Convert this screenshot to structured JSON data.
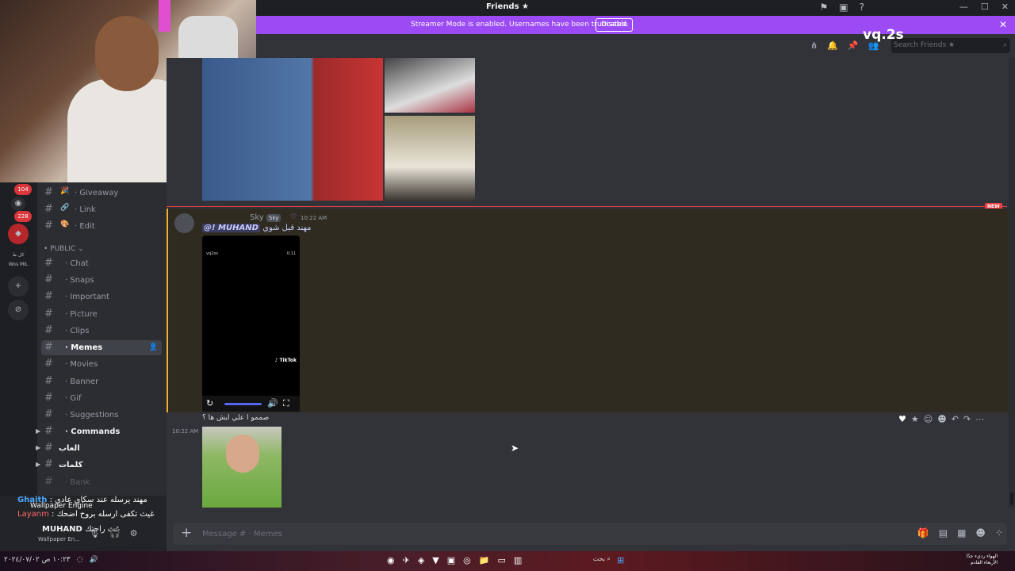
{
  "titlebar": {
    "title": "Friends ★",
    "icons": [
      "flag-icon",
      "inbox-icon",
      "help-icon"
    ]
  },
  "banner": {
    "text": "Streamer Mode is enabled. Usernames have been truncated.",
    "button": "Disable",
    "close": "✕"
  },
  "header": {
    "search_placeholder": "Search Friends ★"
  },
  "watermark": "vq.2s",
  "serverbar": {
    "badges": [
      "104",
      "228"
    ],
    "labels": [
      "كل",
      "ط",
      "Wos MIL"
    ]
  },
  "sidebar": {
    "category": "• PUBLIC ⌄",
    "channels": [
      {
        "name": "· Giveaway",
        "emoji": "🎉"
      },
      {
        "name": "· Link",
        "emoji": "🔗"
      },
      {
        "name": "· Edit",
        "emoji": "🎨"
      },
      {
        "name": "· Chat"
      },
      {
        "name": "· Snaps"
      },
      {
        "name": "· Important"
      },
      {
        "name": "· Picture"
      },
      {
        "name": "· Clips"
      },
      {
        "name": "· Memes",
        "active": true
      },
      {
        "name": "· Movies"
      },
      {
        "name": "· Banner"
      },
      {
        "name": "· Gif"
      },
      {
        "name": "· Suggestions"
      },
      {
        "name": "· Commands"
      },
      {
        "name": "العاب"
      },
      {
        "name": "كلمات"
      },
      {
        "name": "· Bank"
      }
    ]
  },
  "userarea": {
    "overlay_line1_name": "Ghaith",
    "overlay_line1_text": ": مهند يرسله عند سكاي عادي",
    "overlay_line2_name": "Layanm",
    "overlay_line2_text": ": غيث تكفى ارسله بروح اضحك",
    "wallpaper_engine": "Wallpaper Engine",
    "wallpaper_short": "Wallpaper En...",
    "username": "MUHAND",
    "overlap_text": "غث راحتك"
  },
  "message": {
    "author": "Sky",
    "tag": "Sky",
    "time": "10:22 AM",
    "mention": "@! MUHAND",
    "mention_text": "مهند قبل شوي",
    "video_top_left": "vq2os",
    "video_top_right": "0:11",
    "video_brand": "♪ TikTok",
    "second_line": "صممو ا علي ايش ها ؟",
    "time2": "10:22 AM",
    "new_tag": "NEW"
  },
  "composer": {
    "placeholder": "Message # · Memes"
  },
  "taskbar": {
    "search": "بحث",
    "clock_time": "الهواء رديء جدًا",
    "clock_date": "الأربعاء القادم",
    "left_time": "١٠:٢٣ ص",
    "left_date": "٢٠٢٤/٠٧/٠٢"
  }
}
